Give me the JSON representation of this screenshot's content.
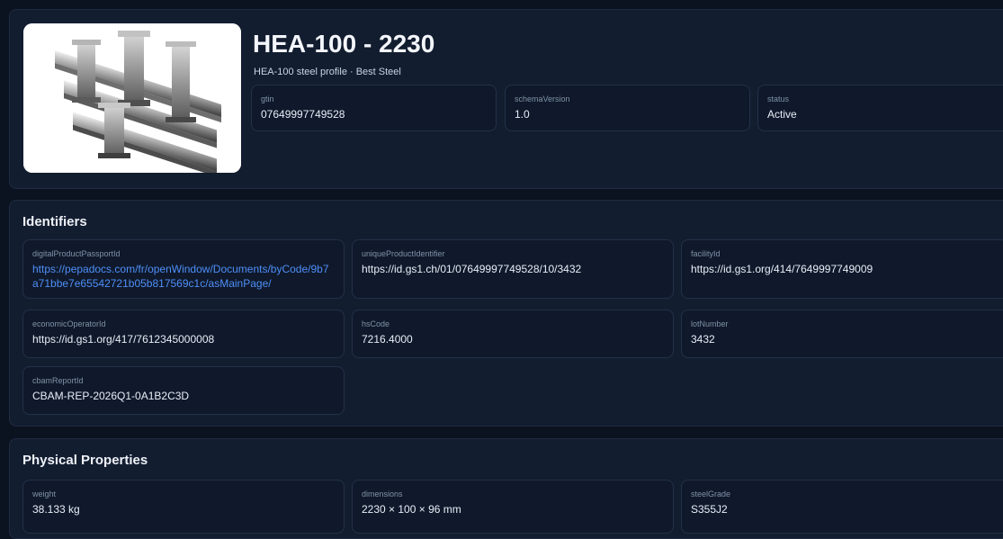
{
  "product": {
    "title": "HEA-100 - 2230",
    "subtitle": "HEA-100 steel profile · Best Steel",
    "image_alt": "steel-beams-photo"
  },
  "summary": [
    {
      "label": "gtin",
      "value": "07649997749528"
    },
    {
      "label": "schemaVersion",
      "value": "1.0"
    },
    {
      "label": "status",
      "value": "Active"
    }
  ],
  "identifiers": {
    "heading": "Identifiers",
    "fields": [
      {
        "label": "digitalProductPassportId",
        "value": "https://pepadocs.com/fr/openWindow/Documents/byCode/9b7a71bbe7e65542721b05b817569c1c/asMainPage/",
        "link": true
      },
      {
        "label": "uniqueProductIdentifier",
        "value": "https://id.gs1.ch/01/07649997749528/10/3432"
      },
      {
        "label": "facilityId",
        "value": "https://id.gs1.org/414/7649997749009"
      },
      {
        "label": "economicOperatorId",
        "value": "https://id.gs1.org/417/7612345000008"
      },
      {
        "label": "hsCode",
        "value": "7216.4000"
      },
      {
        "label": "lotNumber",
        "value": "3432"
      },
      {
        "label": "cbamReportId",
        "value": "CBAM-REP-2026Q1-0A1B2C3D"
      }
    ]
  },
  "physical": {
    "heading": "Physical Properties",
    "fields": [
      {
        "label": "weight",
        "value": "38.133 kg"
      },
      {
        "label": "dimensions",
        "value": "2230 × 100 × 96 mm"
      },
      {
        "label": "steelGrade",
        "value": "S355J2"
      }
    ]
  },
  "colors": {
    "background": "#0b1220",
    "panel": "#131d30",
    "card": "#0f192b",
    "link": "#4f8ef7"
  }
}
